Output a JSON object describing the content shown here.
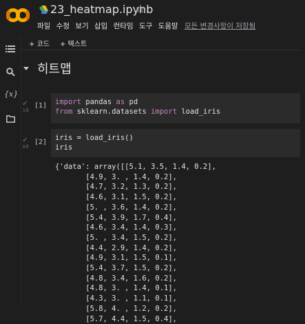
{
  "header": {
    "file_name": "23_heatmap.ipynb",
    "menu": [
      "파일",
      "수정",
      "보기",
      "삽입",
      "런타임",
      "도구",
      "도움말"
    ],
    "saved_text": "모든 변경사항이 저장됨",
    "star_icon": "star-outline-icon",
    "colors": {
      "logo_orange": "#f9ab00",
      "logo_dark_orange": "#e37400"
    }
  },
  "toolbar": {
    "add_code": "+ 코드",
    "add_text": "+ 텍스트"
  },
  "section": {
    "title": "히트맵"
  },
  "cells": [
    {
      "exec_label": "[1]",
      "run_time": "1초",
      "lines": [
        [
          {
            "t": "import",
            "k": true
          },
          {
            "t": " pandas ",
            "k": false
          },
          {
            "t": "as",
            "k": true
          },
          {
            "t": " pd",
            "k": false
          }
        ],
        [
          {
            "t": "from",
            "k": true
          },
          {
            "t": " sklearn.datasets ",
            "k": false
          },
          {
            "t": "import",
            "k": true
          },
          {
            "t": " load_iris",
            "k": false
          }
        ]
      ]
    },
    {
      "exec_label": "[2]",
      "run_time": "0초",
      "lines": [
        [
          {
            "t": "iris = load_iris()",
            "k": false
          }
        ],
        [
          {
            "t": "iris",
            "k": false
          }
        ]
      ]
    }
  ],
  "output_lines": [
    "{'data': array([[5.1, 3.5, 1.4, 0.2],",
    "       [4.9, 3. , 1.4, 0.2],",
    "       [4.7, 3.2, 1.3, 0.2],",
    "       [4.6, 3.1, 1.5, 0.2],",
    "       [5. , 3.6, 1.4, 0.2],",
    "       [5.4, 3.9, 1.7, 0.4],",
    "       [4.6, 3.4, 1.4, 0.3],",
    "       [5. , 3.4, 1.5, 0.2],",
    "       [4.4, 2.9, 1.4, 0.2],",
    "       [4.9, 3.1, 1.5, 0.1],",
    "       [5.4, 3.7, 1.5, 0.2],",
    "       [4.8, 3.4, 1.6, 0.2],",
    "       [4.8, 3. , 1.4, 0.1],",
    "       [4.3, 3. , 1.1, 0.1],",
    "       [5.8, 4. , 1.2, 0.2],",
    "       [5.7, 4.4, 1.5, 0.4],"
  ]
}
